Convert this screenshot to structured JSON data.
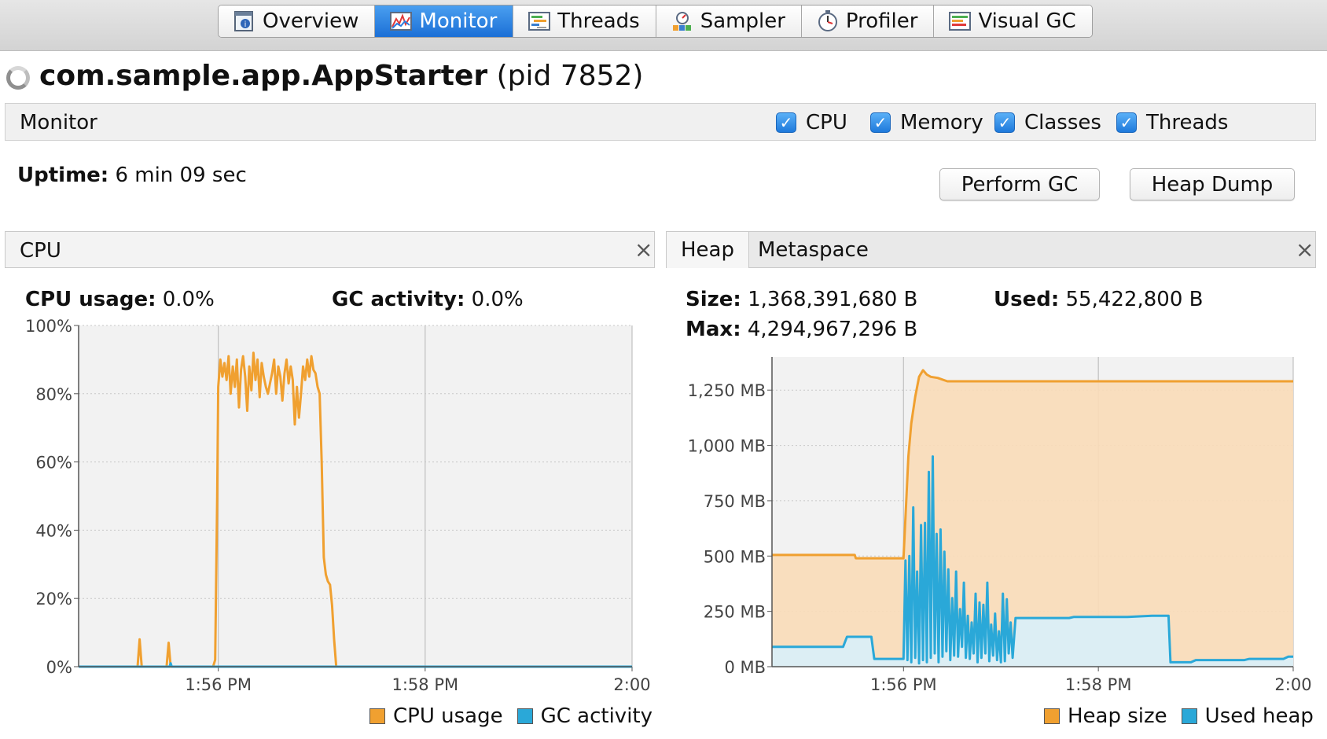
{
  "tabs": [
    {
      "label": "Overview",
      "icon": "overview-icon"
    },
    {
      "label": "Monitor",
      "icon": "monitor-icon",
      "active": true
    },
    {
      "label": "Threads",
      "icon": "threads-icon"
    },
    {
      "label": "Sampler",
      "icon": "sampler-icon"
    },
    {
      "label": "Profiler",
      "icon": "profiler-icon"
    },
    {
      "label": "Visual GC",
      "icon": "visual-gc-icon"
    }
  ],
  "app": {
    "name": "com.sample.app.AppStarter",
    "pid": "(pid 7852)"
  },
  "monitor": {
    "label": "Monitor",
    "checkboxes": [
      {
        "label": "CPU",
        "checked": true
      },
      {
        "label": "Memory",
        "checked": true
      },
      {
        "label": "Classes",
        "checked": true
      },
      {
        "label": "Threads",
        "checked": true
      }
    ],
    "uptime_label": "Uptime:",
    "uptime_value": "6 min 09 sec",
    "perform_gc": "Perform GC",
    "heap_dump": "Heap Dump"
  },
  "cpu_panel": {
    "title": "CPU",
    "usage_label": "CPU usage:",
    "usage_value": "0.0%",
    "gc_label": "GC activity:",
    "gc_value": "0.0%",
    "legend": [
      {
        "label": "CPU usage",
        "color": "#f0a030"
      },
      {
        "label": "GC activity",
        "color": "#2aa8d8"
      }
    ]
  },
  "heap_panel": {
    "tabs": [
      "Heap",
      "Metaspace"
    ],
    "active_tab": "Heap",
    "size_label": "Size:",
    "size_value": "1,368,391,680 B",
    "used_label": "Used:",
    "used_value": "55,422,800 B",
    "max_label": "Max:",
    "max_value": "4,294,967,296 B",
    "legend": [
      {
        "label": "Heap size",
        "color": "#f0a030"
      },
      {
        "label": "Used heap",
        "color": "#2aa8d8"
      }
    ]
  },
  "chart_data": [
    {
      "type": "line",
      "title": "CPU",
      "x_unit": "minutes after 1:56 PM",
      "xlim": [
        -1.35,
        4.0
      ],
      "x_ticks": [
        {
          "x": 0,
          "label": "1:56 PM"
        },
        {
          "x": 2,
          "label": "1:58 PM"
        },
        {
          "x": 4,
          "label": "2:00"
        }
      ],
      "ylim": [
        0,
        100
      ],
      "y_ticks": [
        "0%",
        "20%",
        "40%",
        "60%",
        "80%",
        "100%"
      ],
      "grid": true,
      "series": [
        {
          "name": "CPU usage",
          "color": "#f0a030",
          "x": [
            -1.35,
            -0.78,
            -0.76,
            -0.74,
            -0.72,
            -0.5,
            -0.48,
            -0.46,
            -0.44,
            -0.05,
            -0.03,
            -0.01,
            0.0,
            0.02,
            0.04,
            0.06,
            0.08,
            0.1,
            0.12,
            0.14,
            0.16,
            0.18,
            0.2,
            0.22,
            0.24,
            0.26,
            0.28,
            0.3,
            0.32,
            0.34,
            0.36,
            0.38,
            0.4,
            0.42,
            0.44,
            0.46,
            0.48,
            0.5,
            0.52,
            0.54,
            0.56,
            0.58,
            0.6,
            0.62,
            0.64,
            0.66,
            0.68,
            0.7,
            0.72,
            0.74,
            0.76,
            0.78,
            0.8,
            0.82,
            0.84,
            0.86,
            0.88,
            0.9,
            0.92,
            0.94,
            0.96,
            0.98,
            1.0,
            1.02,
            1.04,
            1.06,
            1.08,
            1.1,
            1.12,
            1.14,
            1.16,
            1.18,
            1.2,
            1.22,
            4.0
          ],
          "y": [
            0,
            0,
            8,
            0,
            0,
            0,
            7,
            0,
            0,
            0,
            2,
            50,
            82,
            90,
            85,
            89,
            84,
            91,
            80,
            88,
            82,
            90,
            76,
            87,
            91,
            85,
            75,
            88,
            81,
            92,
            84,
            90,
            79,
            89,
            85,
            82,
            80,
            83,
            86,
            90,
            80,
            88,
            85,
            78,
            86,
            90,
            83,
            88,
            84,
            71,
            82,
            73,
            80,
            88,
            84,
            90,
            85,
            91,
            87,
            86,
            82,
            80,
            60,
            32,
            27,
            25,
            24,
            18,
            8,
            0,
            0,
            0,
            0,
            0,
            0
          ]
        },
        {
          "name": "GC activity",
          "color": "#2aa8d8",
          "x": [
            -1.35,
            -0.47,
            -0.46,
            -0.45,
            4.0
          ],
          "y": [
            0,
            0,
            1,
            0,
            0
          ]
        }
      ]
    },
    {
      "type": "area",
      "title": "Heap",
      "x_unit": "minutes after 1:56 PM",
      "xlim": [
        -1.35,
        4.0
      ],
      "x_ticks": [
        {
          "x": 0,
          "label": "1:56 PM"
        },
        {
          "x": 2,
          "label": "1:58 PM"
        },
        {
          "x": 4,
          "label": "2:00"
        }
      ],
      "ylim": [
        0,
        1400
      ],
      "y_ticks": [
        "0 MB",
        "250 MB",
        "500 MB",
        "750 MB",
        "1,000 MB",
        "1,250 MB"
      ],
      "grid": true,
      "series": [
        {
          "name": "Heap size",
          "color": "#f0a030",
          "x": [
            -1.35,
            -0.5,
            -0.49,
            0.0,
            0.05,
            0.08,
            0.12,
            0.16,
            0.2,
            0.24,
            0.28,
            0.35,
            0.45,
            0.65,
            4.0
          ],
          "y": [
            505,
            505,
            490,
            490,
            950,
            1100,
            1220,
            1310,
            1340,
            1320,
            1310,
            1305,
            1290,
            1290,
            1290
          ]
        },
        {
          "name": "Used heap",
          "color": "#2aa8d8",
          "x": [
            -1.35,
            -0.62,
            -0.58,
            -0.33,
            -0.3,
            0.0,
            0.02,
            0.04,
            0.06,
            0.08,
            0.1,
            0.12,
            0.14,
            0.16,
            0.18,
            0.2,
            0.22,
            0.24,
            0.26,
            0.28,
            0.3,
            0.32,
            0.34,
            0.36,
            0.38,
            0.4,
            0.42,
            0.44,
            0.46,
            0.48,
            0.5,
            0.52,
            0.54,
            0.56,
            0.58,
            0.6,
            0.62,
            0.64,
            0.66,
            0.68,
            0.7,
            0.72,
            0.74,
            0.76,
            0.78,
            0.8,
            0.82,
            0.84,
            0.86,
            0.88,
            0.9,
            0.92,
            0.94,
            0.96,
            0.98,
            1.0,
            1.02,
            1.04,
            1.06,
            1.08,
            1.1,
            1.12,
            1.15,
            1.2,
            1.7,
            1.75,
            2.3,
            2.55,
            2.72,
            2.74,
            2.95,
            3.0,
            3.5,
            3.55,
            3.9,
            3.95,
            4.0
          ],
          "y": [
            90,
            90,
            135,
            135,
            35,
            35,
            480,
            30,
            500,
            20,
            720,
            40,
            430,
            15,
            640,
            30,
            650,
            20,
            880,
            40,
            950,
            60,
            600,
            20,
            620,
            45,
            520,
            70,
            440,
            30,
            310,
            50,
            430,
            45,
            260,
            90,
            380,
            40,
            230,
            35,
            200,
            60,
            330,
            20,
            290,
            40,
            280,
            60,
            380,
            25,
            190,
            50,
            240,
            30,
            160,
            20,
            330,
            25,
            305,
            60,
            200,
            40,
            220,
            220,
            220,
            225,
            225,
            230,
            230,
            20,
            20,
            30,
            30,
            35,
            35,
            45,
            45
          ]
        }
      ]
    }
  ]
}
